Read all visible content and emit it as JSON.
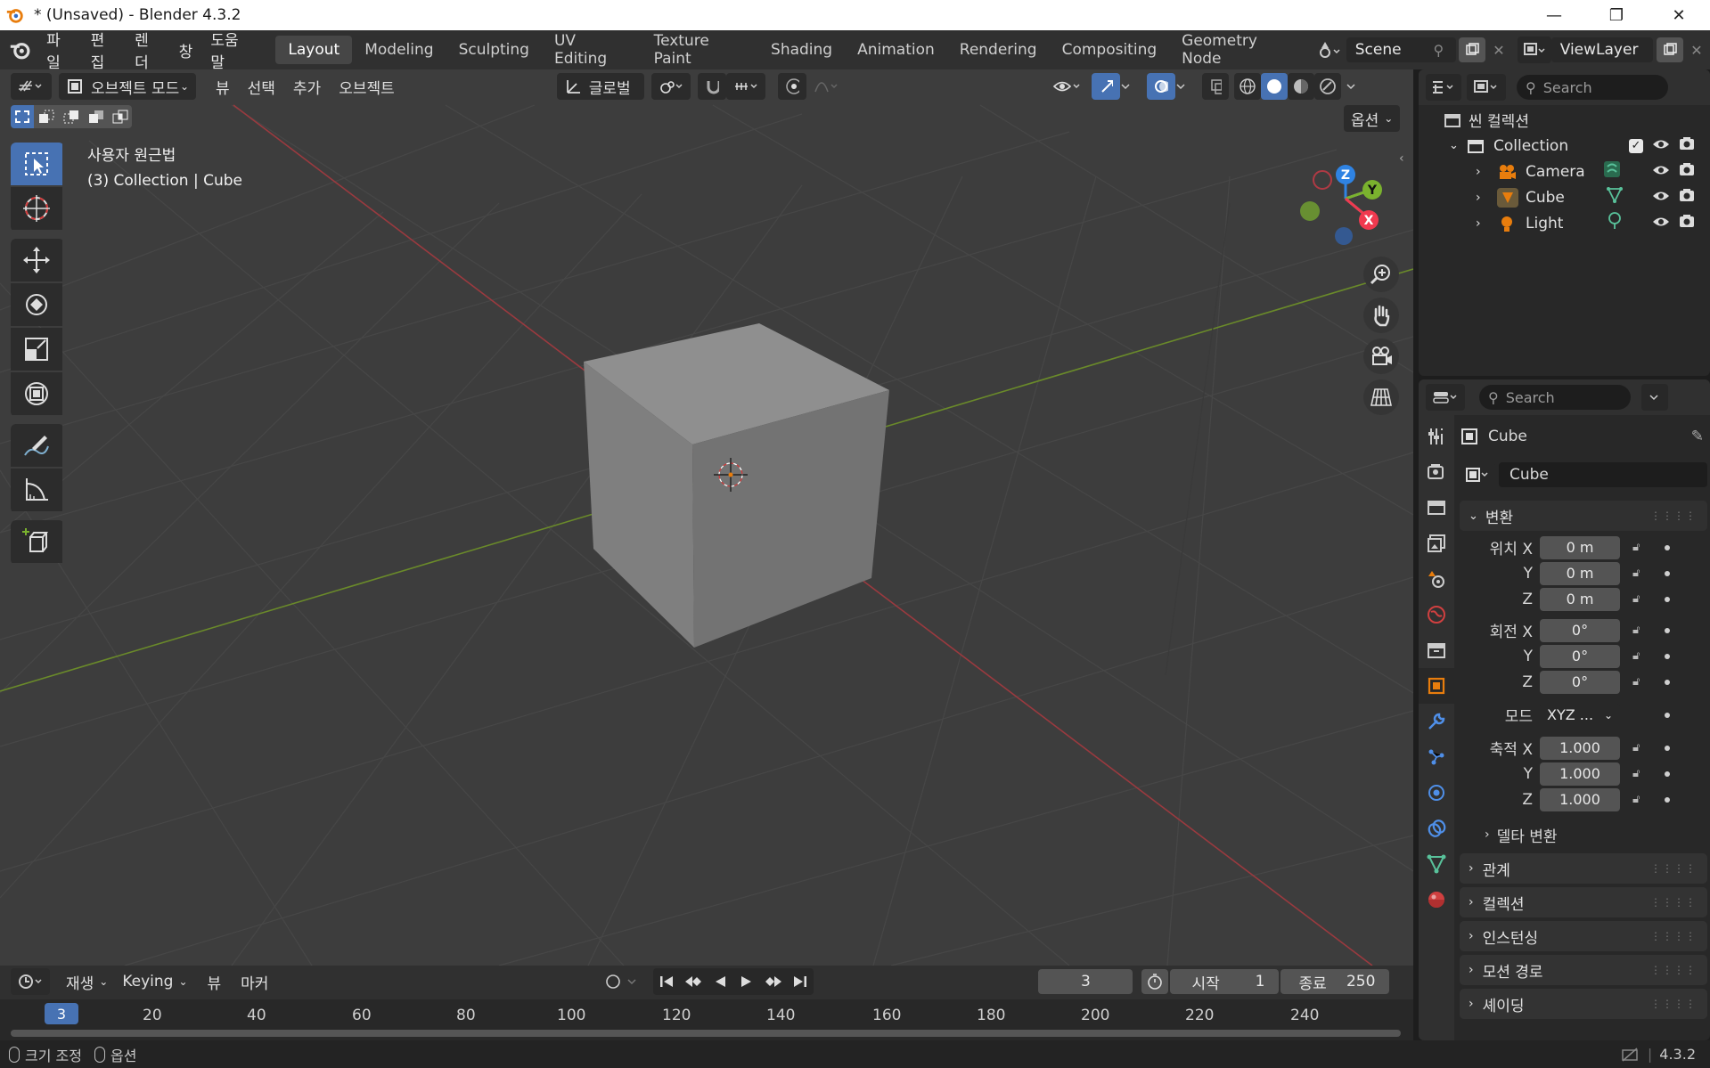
{
  "window": {
    "title": "* (Unsaved) - Blender 4.3.2",
    "minimize": "—",
    "maximize": "❐",
    "close": "✕"
  },
  "topbar": {
    "menus": [
      "파일",
      "편집",
      "렌더",
      "창",
      "도움말"
    ],
    "workspaces": [
      "Layout",
      "Modeling",
      "Sculpting",
      "UV Editing",
      "Texture Paint",
      "Shading",
      "Animation",
      "Rendering",
      "Compositing",
      "Geometry Node"
    ],
    "active_workspace": "Layout",
    "scene": "Scene",
    "view_layer": "ViewLayer"
  },
  "viewport": {
    "mode": "오브젝트 모드",
    "menus": [
      "뷰",
      "선택",
      "추가",
      "오브젝트"
    ],
    "transform_orientation": "글로벌",
    "options": "옵션",
    "view_name": "사용자 원근법",
    "view_context": "(3) Collection | Cube",
    "gizmo_axes": {
      "z": "Z",
      "y": "Y",
      "x": "X"
    }
  },
  "outliner": {
    "search_placeholder": "Search",
    "scene_collection": "씬 컬렉션",
    "collection": "Collection",
    "items": [
      "Camera",
      "Cube",
      "Light"
    ]
  },
  "properties": {
    "search_placeholder": "Search",
    "object_name": "Cube",
    "object_field": "Cube",
    "transform_title": "변환",
    "location_label": "위치",
    "rotation_label": "회전",
    "mode_label": "모드",
    "scale_label": "축적",
    "axes": [
      "X",
      "Y",
      "Z"
    ],
    "location": [
      "0 m",
      "0 m",
      "0 m"
    ],
    "rotation": [
      "0°",
      "0°",
      "0°"
    ],
    "rotation_mode": "XYZ ...",
    "scale": [
      "1.000",
      "1.000",
      "1.000"
    ],
    "delta_transform": "델타 변환",
    "collapsed_panels": [
      "관계",
      "컬렉션",
      "인스턴싱",
      "모션 경로",
      "셰이딩"
    ]
  },
  "timeline": {
    "playback": "재생",
    "keying": "Keying",
    "view": "뷰",
    "marker": "마커",
    "current_frame": "3",
    "start_label": "시작",
    "start": "1",
    "end_label": "종료",
    "end": "250",
    "ruler_labels": [
      "20",
      "40",
      "60",
      "80",
      "100",
      "120",
      "140",
      "160",
      "180",
      "200",
      "220",
      "240"
    ],
    "playhead": "3"
  },
  "statusbar": {
    "left1": "크기 조정",
    "left2": "옵션",
    "version": "4.3.2"
  },
  "colors": {
    "accent": "#4772b3",
    "x_axis": "#f0394f",
    "y_axis": "#7ab22e",
    "z_axis": "#2f83e3",
    "object_orange": "#e87d0d"
  }
}
